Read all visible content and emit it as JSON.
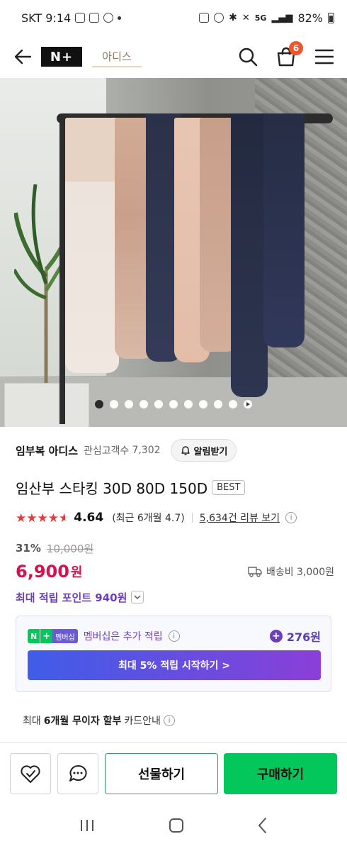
{
  "status_bar": {
    "carrier_time": "SKT 9:14",
    "network": "5G",
    "battery": "82%"
  },
  "header": {
    "nplus_logo": "N+",
    "store_logo_text": "아디스",
    "cart_count": "6",
    "icons": [
      "back-arrow-icon",
      "search-icon",
      "cart-icon",
      "menu-icon"
    ]
  },
  "gallery": {
    "total_images": 10,
    "active_index": 0
  },
  "store": {
    "name": "임부복 아디스",
    "follower_label": "관심고객수",
    "follower_count": "7,302",
    "alarm_label": "알림받기"
  },
  "product": {
    "title": "임산부 스타킹 30D 80D 150D",
    "badge": "BEST",
    "rating": "4.64",
    "rating_recent": "(최근 6개월 4.7)",
    "review_link": "5,634건 리뷰 보기",
    "discount": "31%",
    "original_price": "10,000원",
    "price": "6,900",
    "price_unit": "원",
    "shipping": "배송비 3,000원",
    "max_points": "최대 적립 포인트 940원"
  },
  "membership": {
    "badge_n": "N",
    "badge_plus": "+",
    "badge_label": "멤버십",
    "text": "멤버십은 추가 적립",
    "points": "276원",
    "cta": "최대 5% 적립 시작하기 >"
  },
  "card_info": {
    "prefix": "최대",
    "bold": "6개월 무이자 할부",
    "suffix": "카드안내"
  },
  "actions": {
    "gift": "선물하기",
    "buy": "구매하기"
  },
  "colors": {
    "price_red": "#d6114b",
    "point_purple": "#6b3fb8",
    "naver_green": "#03c75a",
    "cart_badge": "#f2542d"
  }
}
